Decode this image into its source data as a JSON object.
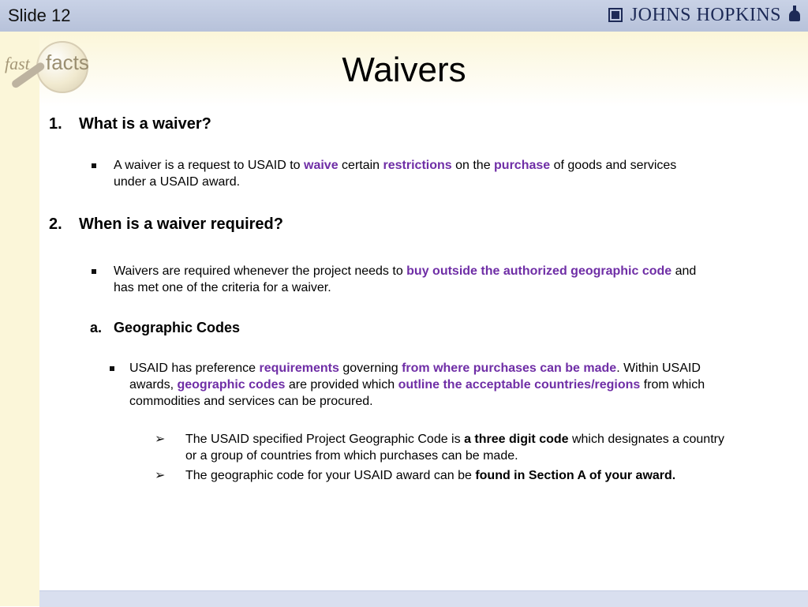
{
  "top": {
    "slide_label": "Slide 12",
    "brand": {
      "text": "JOHNS HOPKINS",
      "icon": "johns-hopkins-logo"
    }
  },
  "side_logo": {
    "fast": "fast",
    "facts": "facts",
    "icon": "magnifying-glass"
  },
  "title": "Waivers",
  "sections": {
    "s1": {
      "number": "1.",
      "heading": "What is a waiver?",
      "bullet": {
        "t1": "A waiver is a request to USAID to ",
        "e1": "waive",
        "t2": " certain ",
        "e2": "restrictions",
        "t3": " on the ",
        "e3": "purchase",
        "t4": " of goods and services",
        "t5": "under a USAID award."
      }
    },
    "s2": {
      "number": "2.",
      "heading": "When is a waiver required?",
      "bullet": {
        "t1": "Waivers are required whenever the project needs to ",
        "e1": "buy outside the authorized geographic code",
        "t2": " and",
        "t3": "has met one of the criteria for a waiver."
      },
      "sub": {
        "letter": "a.",
        "heading": "Geographic Codes",
        "bullet": {
          "l1a": "USAID has preference ",
          "l1b": "requirements",
          "l1c": " governing ",
          "l1d": "from where purchases can be made",
          "l1e": ". Within USAID",
          "l2a": "awards, ",
          "l2b": "geographic codes",
          "l2c": " are provided which ",
          "l2d": "outline the acceptable countries/regions",
          "l2e": " from which",
          "l3": "commodities and services can be procured."
        },
        "chev_items": [
          {
            "a": "The USAID specified Project Geographic Code is ",
            "b": "a three digit code",
            "c": " which designates a country",
            "d": "or a group of countries from which purchases can be made."
          },
          {
            "a": "The geographic code for your USAID award can be ",
            "b": "found in Section A of your award."
          }
        ]
      }
    }
  },
  "colors": {
    "accent_purple": "#6f2ea6",
    "top_bar": "#c2cbe1",
    "cream": "#fbf6d9",
    "brand_navy": "#1d2a57"
  }
}
